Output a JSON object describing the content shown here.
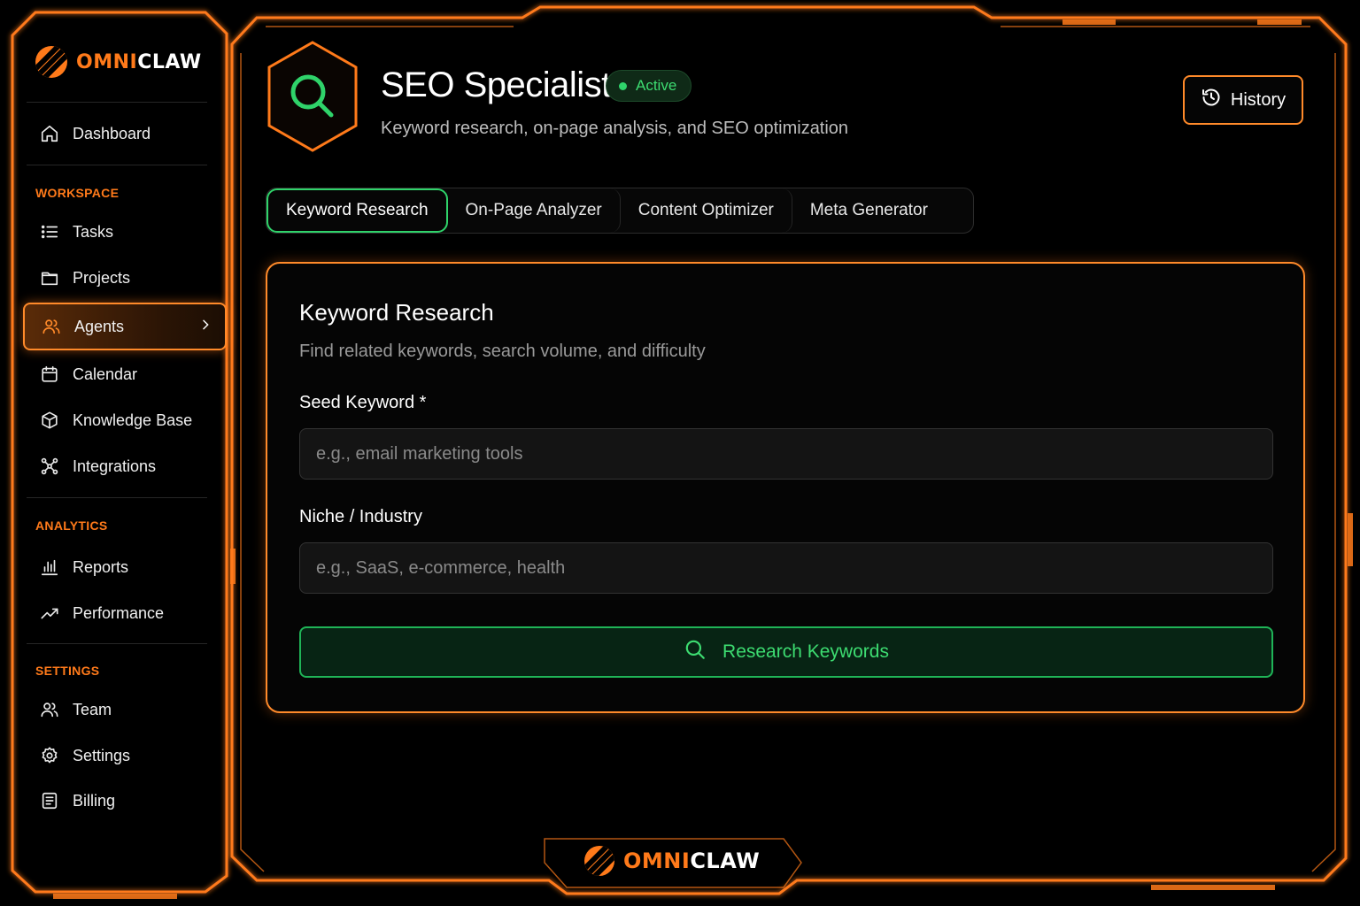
{
  "brand": {
    "name_part1": "OMNI",
    "name_part2": "CLAW"
  },
  "colors": {
    "accent": "#ff7a1a",
    "success": "#2fd36a",
    "background": "#000000"
  },
  "sidebar": {
    "top_item": {
      "label": "Dashboard",
      "icon": "home-icon"
    },
    "sections": [
      {
        "label": "WORKSPACE",
        "items": [
          {
            "label": "Tasks",
            "icon": "list-icon"
          },
          {
            "label": "Projects",
            "icon": "folder-icon"
          },
          {
            "label": "Agents",
            "icon": "users-icon",
            "active": true
          },
          {
            "label": "Calendar",
            "icon": "calendar-icon"
          },
          {
            "label": "Knowledge Base",
            "icon": "cube-icon"
          },
          {
            "label": "Integrations",
            "icon": "nodes-icon"
          }
        ]
      },
      {
        "label": "ANALYTICS",
        "items": [
          {
            "label": "Reports",
            "icon": "bar-chart-icon"
          },
          {
            "label": "Performance",
            "icon": "trend-icon"
          }
        ]
      },
      {
        "label": "SETTINGS",
        "items": [
          {
            "label": "Team",
            "icon": "team-icon"
          },
          {
            "label": "Settings",
            "icon": "gear-icon"
          },
          {
            "label": "Billing",
            "icon": "receipt-icon"
          }
        ]
      }
    ]
  },
  "header": {
    "title": "SEO Specialist",
    "status": "Active",
    "subtitle": "Keyword research, on-page analysis, and SEO optimization",
    "history_label": "History"
  },
  "tabs": [
    {
      "label": "Keyword Research",
      "active": true
    },
    {
      "label": "On-Page Analyzer"
    },
    {
      "label": "Content Optimizer"
    },
    {
      "label": "Meta Generator"
    }
  ],
  "form": {
    "title": "Keyword Research",
    "subtitle": "Find related keywords, search volume, and difficulty",
    "seed": {
      "label": "Seed Keyword *",
      "placeholder": "e.g., email marketing tools",
      "value": ""
    },
    "niche": {
      "label": "Niche / Industry",
      "placeholder": "e.g., SaaS, e-commerce, health",
      "value": ""
    },
    "submit_label": "Research Keywords"
  }
}
